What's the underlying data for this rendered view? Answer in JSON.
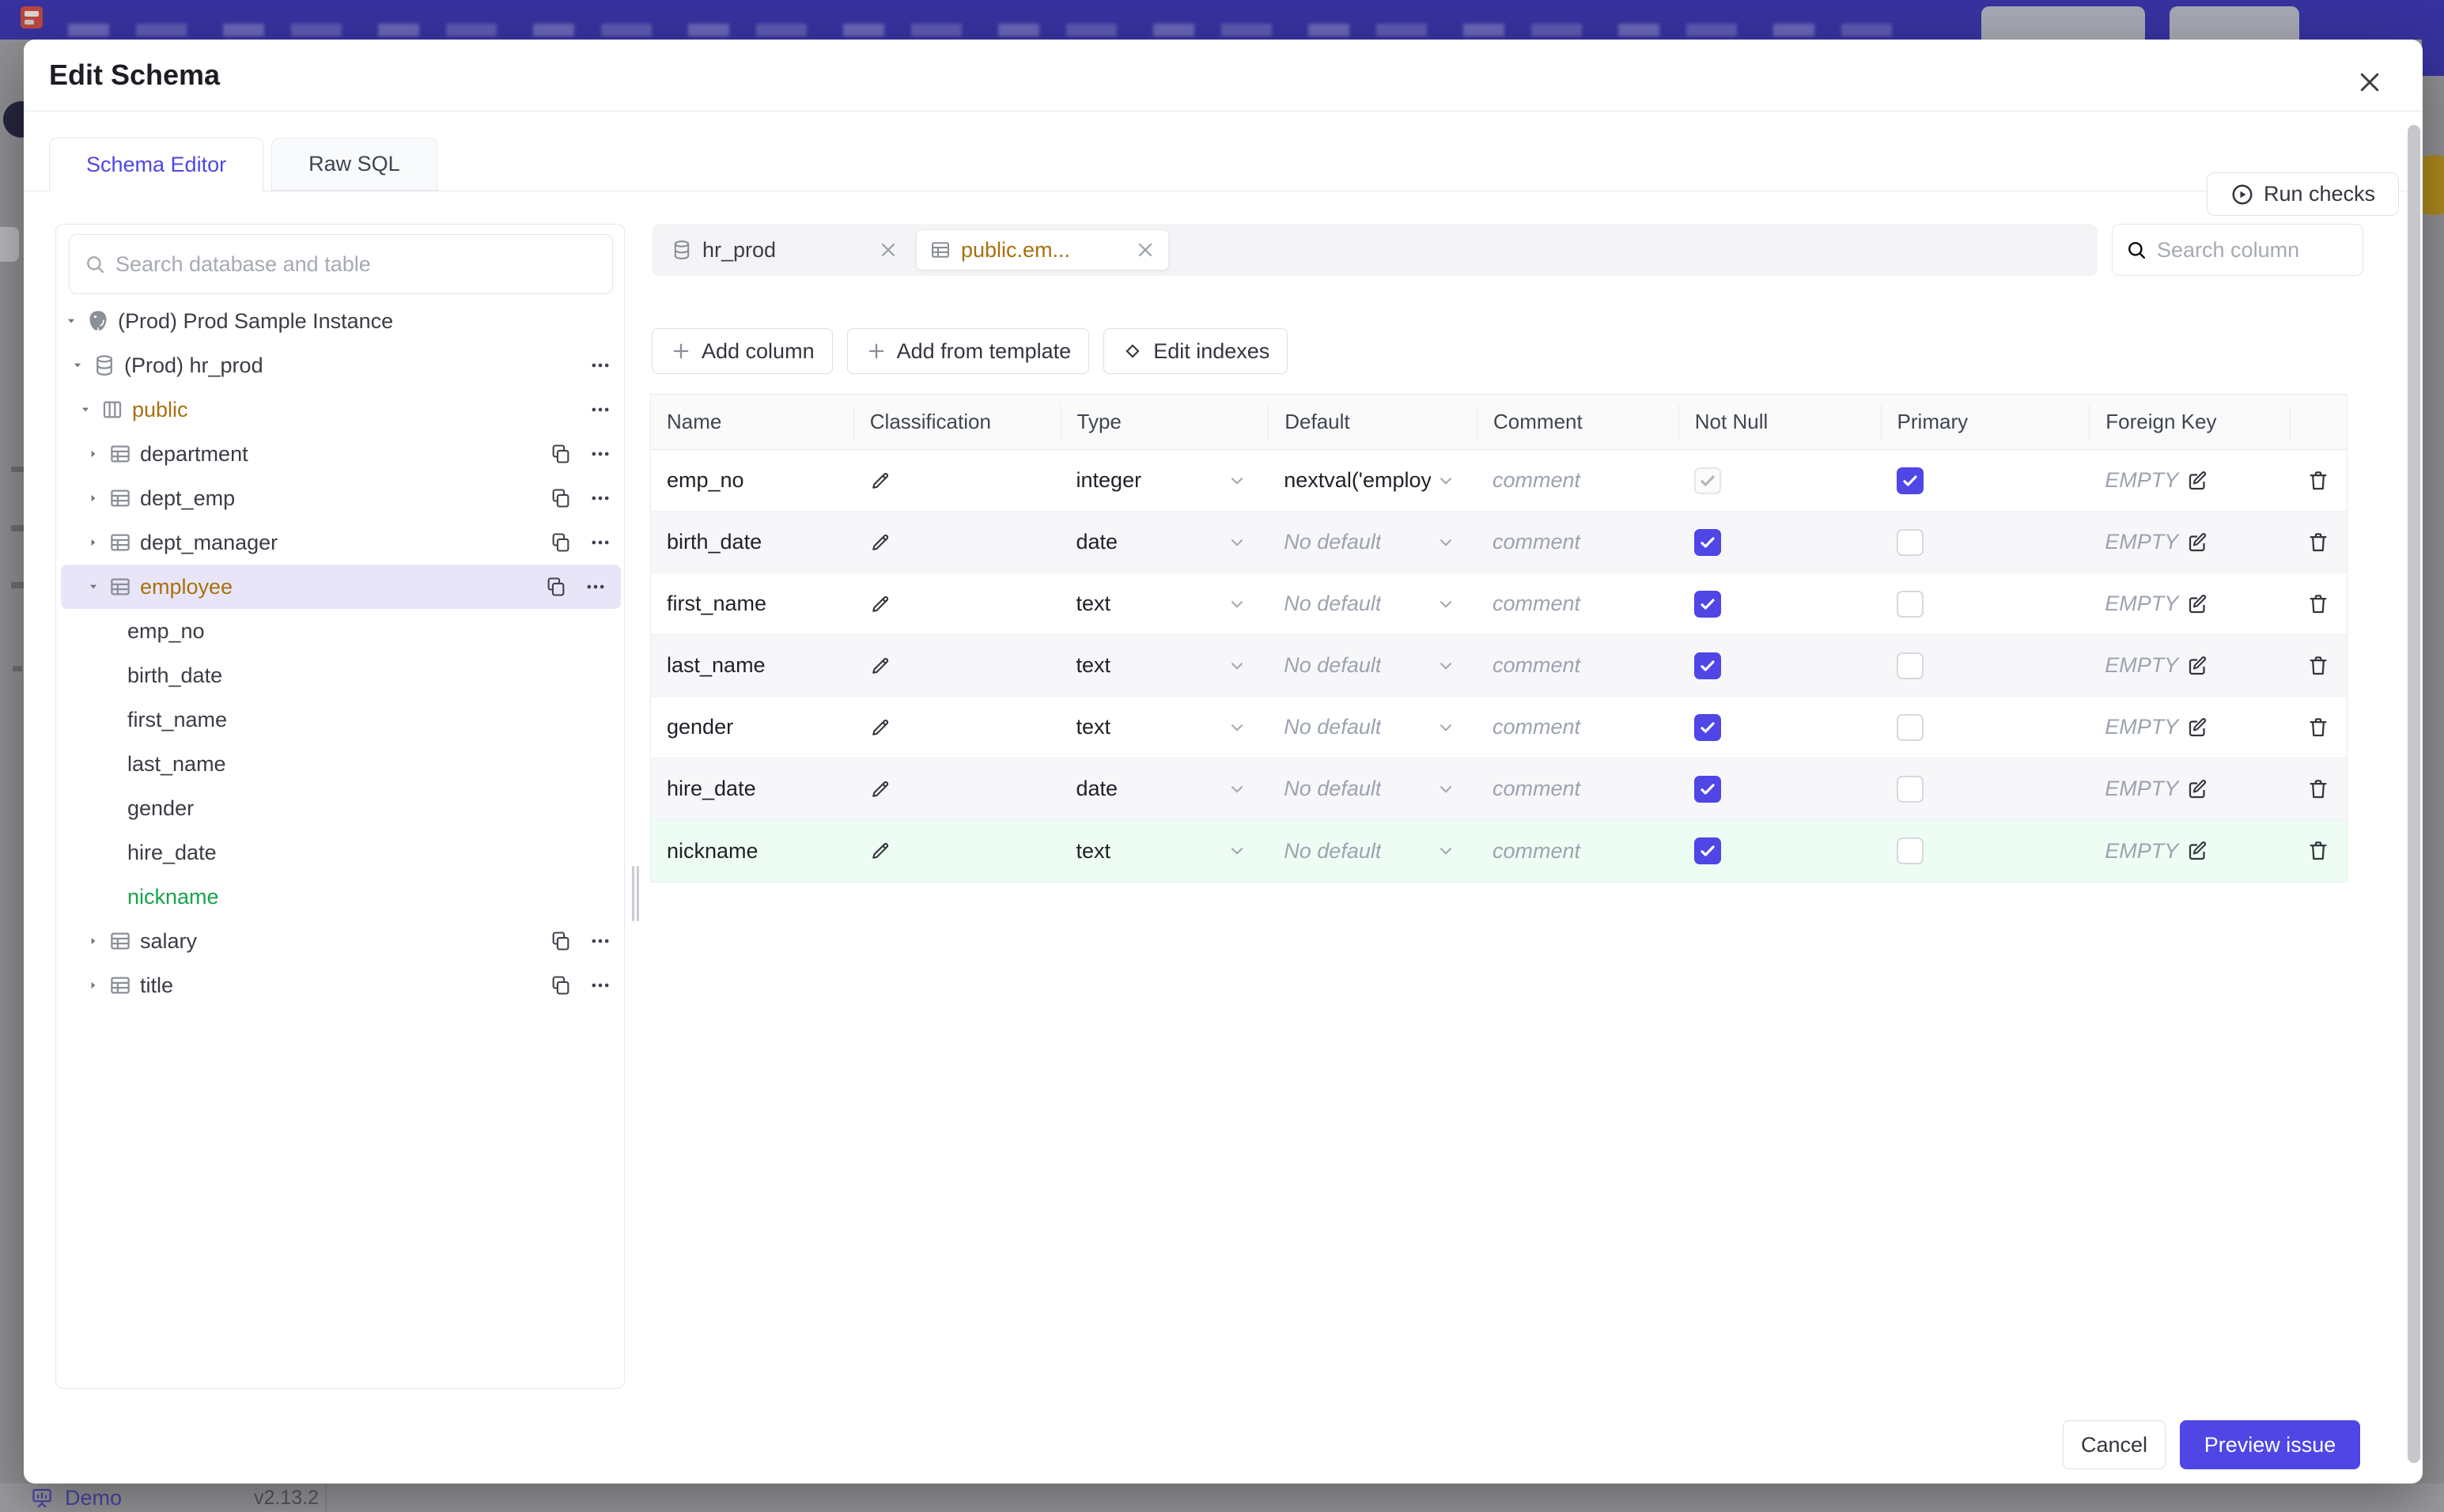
{
  "page": {
    "footer": {
      "demo_label": "Demo",
      "version": "v2.13.2"
    }
  },
  "modal": {
    "title": "Edit Schema",
    "tabs": [
      {
        "label": "Schema Editor"
      },
      {
        "label": "Raw SQL"
      }
    ],
    "active_tab": "Schema Editor",
    "run_checks_label": "Run checks",
    "sidebar": {
      "search_placeholder": "Search database and table",
      "tree": [
        {
          "label": "(Prod) Prod Sample Instance",
          "icon": "postgres",
          "level": 0,
          "caret": "down"
        },
        {
          "label": "(Prod) hr_prod",
          "icon": "database",
          "level": 1,
          "caret": "down",
          "kebab": true
        },
        {
          "label": "public",
          "icon": "schema",
          "level": 2,
          "caret": "down",
          "kebab": true,
          "tone": "amber"
        },
        {
          "label": "department",
          "icon": "table",
          "level": 3,
          "caret": "right",
          "copy": true,
          "kebab": true
        },
        {
          "label": "dept_emp",
          "icon": "table",
          "level": 3,
          "caret": "right",
          "copy": true,
          "kebab": true
        },
        {
          "label": "dept_manager",
          "icon": "table",
          "level": 3,
          "caret": "right",
          "copy": true,
          "kebab": true
        },
        {
          "label": "employee",
          "icon": "table",
          "level": 3,
          "caret": "down",
          "copy": true,
          "kebab": true,
          "tone": "amber",
          "selected": true
        },
        {
          "label": "emp_no",
          "level": 4
        },
        {
          "label": "birth_date",
          "level": 4
        },
        {
          "label": "first_name",
          "level": 4
        },
        {
          "label": "last_name",
          "level": 4
        },
        {
          "label": "gender",
          "level": 4
        },
        {
          "label": "hire_date",
          "level": 4
        },
        {
          "label": "nickname",
          "level": 4,
          "tone": "green"
        },
        {
          "label": "salary",
          "icon": "table",
          "level": 3,
          "caret": "right",
          "copy": true,
          "kebab": true
        },
        {
          "label": "title",
          "icon": "table",
          "level": 3,
          "caret": "right",
          "copy": true,
          "kebab": true
        }
      ]
    },
    "editor": {
      "chips": [
        {
          "label": "hr_prod",
          "icon": "database",
          "active": false
        },
        {
          "label": "public.em...",
          "icon": "table",
          "active": true
        }
      ],
      "column_search_placeholder": "Search column",
      "toolbar": [
        {
          "label": "Add column",
          "icon": "plus"
        },
        {
          "label": "Add from template",
          "icon": "plus"
        },
        {
          "label": "Edit indexes",
          "icon": "diamond"
        }
      ],
      "table": {
        "headers": [
          "Name",
          "Classification",
          "Type",
          "Default",
          "Comment",
          "Not Null",
          "Primary",
          "Foreign Key",
          ""
        ],
        "comment_placeholder": "comment",
        "foreign_key_empty": "EMPTY",
        "no_default_label": "No default",
        "rows": [
          {
            "name": "emp_no",
            "type": "integer",
            "default": "nextval('employ",
            "has_default": true,
            "not_null": "disabled",
            "primary": "on"
          },
          {
            "name": "birth_date",
            "type": "date",
            "has_default": false,
            "not_null": "on",
            "primary": "off",
            "zebra": true
          },
          {
            "name": "first_name",
            "type": "text",
            "has_default": false,
            "not_null": "on",
            "primary": "off"
          },
          {
            "name": "last_name",
            "type": "text",
            "has_default": false,
            "not_null": "on",
            "primary": "off",
            "zebra": true
          },
          {
            "name": "gender",
            "type": "text",
            "has_default": false,
            "not_null": "on",
            "primary": "off"
          },
          {
            "name": "hire_date",
            "type": "date",
            "has_default": false,
            "not_null": "on",
            "primary": "off",
            "zebra": true
          },
          {
            "name": "nickname",
            "type": "text",
            "has_default": false,
            "not_null": "on",
            "primary": "off",
            "highlight": true
          }
        ]
      }
    },
    "footer": {
      "cancel_label": "Cancel",
      "submit_label": "Preview issue"
    }
  },
  "colors": {
    "accent": "#4f46e5",
    "amber_text": "#a9700e",
    "green_text": "#16a34a",
    "green_row_bg": "#edfdf4",
    "selected_tree_bg": "#e8e5f8",
    "topbar": "#37329e",
    "zebra_row_bg": "#f7f7f9"
  }
}
